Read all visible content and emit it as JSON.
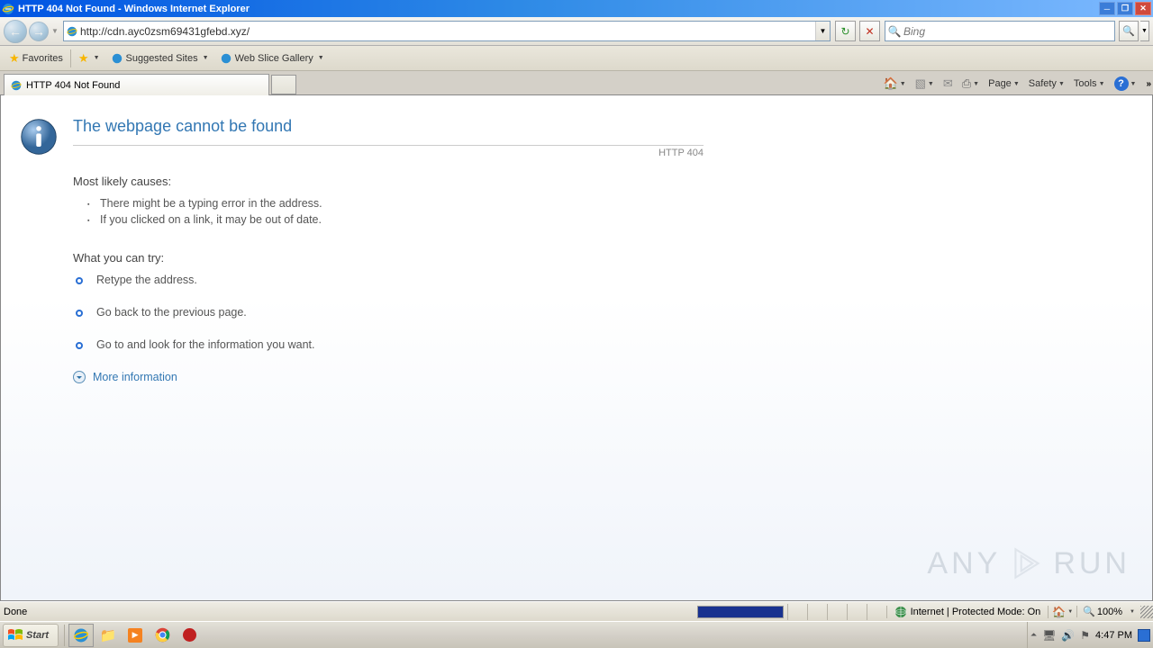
{
  "titlebar": {
    "text": "HTTP 404 Not Found - Windows Internet Explorer"
  },
  "address": {
    "url": "http://cdn.ayc0zsm69431gfebd.xyz/"
  },
  "search": {
    "placeholder": "Bing"
  },
  "favbar": {
    "favorites": "Favorites",
    "suggested": "Suggested Sites",
    "webslice": "Web Slice Gallery"
  },
  "tab": {
    "title": "HTTP 404 Not Found"
  },
  "cmdbar": {
    "page": "Page",
    "safety": "Safety",
    "tools": "Tools"
  },
  "error": {
    "title": "The webpage cannot be found",
    "code": "HTTP 404",
    "causes_head": "Most likely causes:",
    "causes": [
      "There might be a typing error in the address.",
      "If you clicked on a link, it may be out of date."
    ],
    "try_head": "What you can try:",
    "actions": [
      "Retype the address.",
      "Go back to the previous page.",
      "Go to  and look for the information you want."
    ],
    "more": "More information"
  },
  "statusbar": {
    "done": "Done",
    "zone": "Internet | Protected Mode: On",
    "zoom": "100%"
  },
  "taskbar": {
    "start": "Start",
    "time": "4:47 PM"
  },
  "watermark": {
    "text1": "ANY",
    "text2": "RUN"
  }
}
